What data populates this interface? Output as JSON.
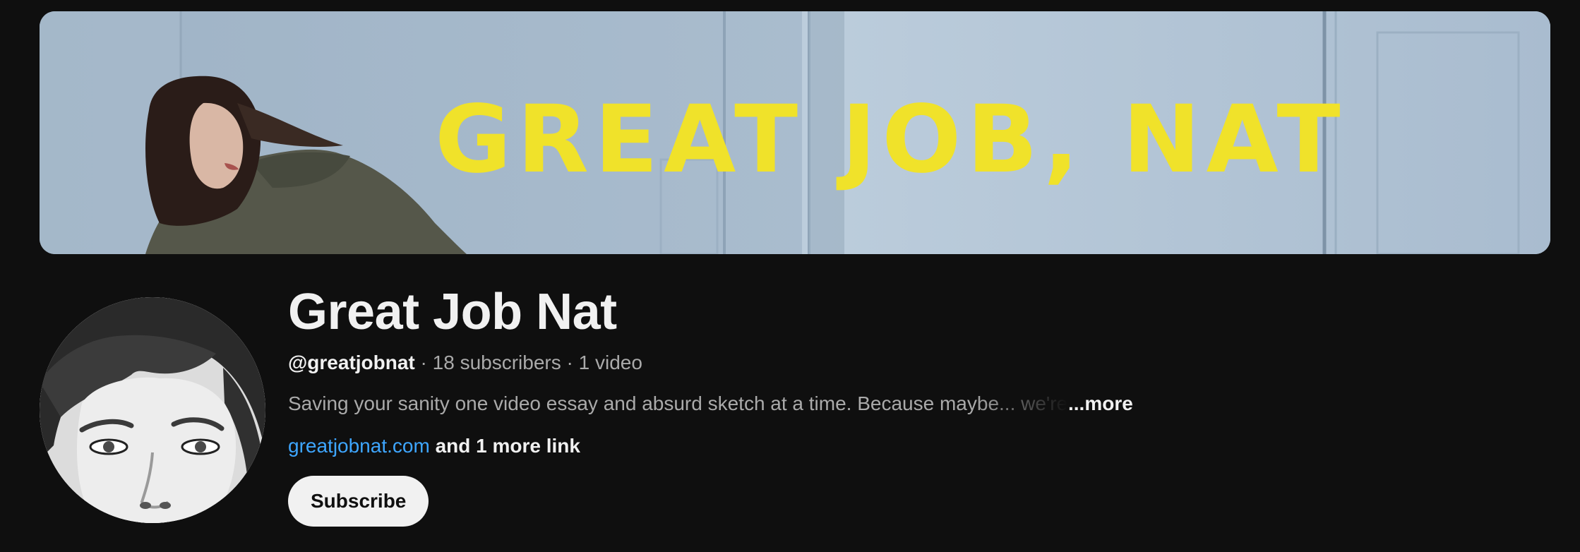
{
  "banner": {
    "title": "GREAT JOB, NAT",
    "title_color": "#f0e22a"
  },
  "channel": {
    "name": "Great Job Nat",
    "handle": "@greatjobnat",
    "subscribers": "18 subscribers",
    "videos": "1 video",
    "separator": "·",
    "description": "Saving your sanity one video essay and absurd sketch at a time. Because maybe... we're not alone.",
    "more_label": "...more",
    "link_primary": "greatjobnat.com",
    "link_more": "and 1 more link",
    "subscribe_label": "Subscribe"
  },
  "colors": {
    "background": "#0f0f0f",
    "text_primary": "#f1f1f1",
    "text_secondary": "#aaaaaa",
    "link": "#3ea6ff"
  },
  "icons": {
    "avatar": "channel-avatar-portrait"
  }
}
